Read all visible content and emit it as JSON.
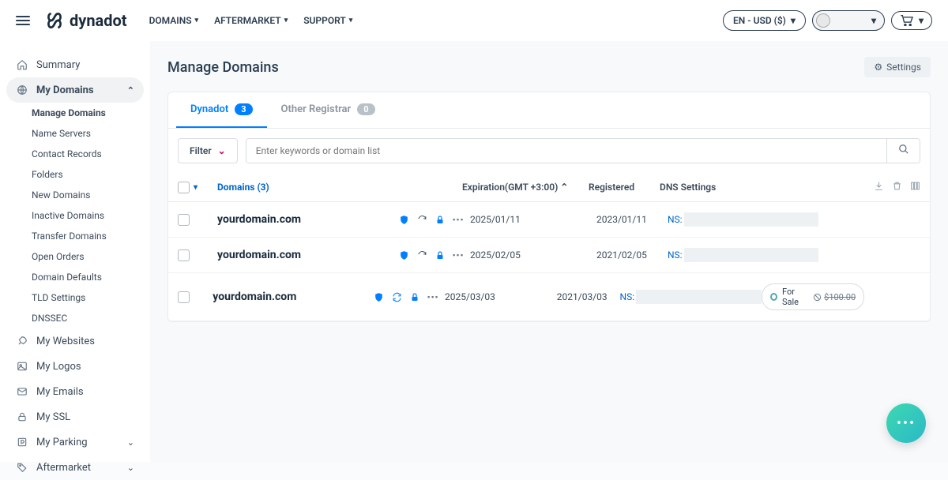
{
  "header": {
    "brand": "dynadot",
    "nav": [
      "DOMAINS",
      "AFTERMARKET",
      "SUPPORT"
    ],
    "locale": "EN - USD ($)"
  },
  "sidebar": {
    "summary": "Summary",
    "myDomains": "My Domains",
    "sub": {
      "manage": "Manage Domains",
      "ns": "Name Servers",
      "contacts": "Contact Records",
      "folders": "Folders",
      "newd": "New Domains",
      "inactive": "Inactive Domains",
      "transfer": "Transfer Domains",
      "open": "Open Orders",
      "defaults": "Domain Defaults",
      "tld": "TLD Settings",
      "dnssec": "DNSSEC"
    },
    "myWebsites": "My Websites",
    "myLogos": "My Logos",
    "myEmails": "My Emails",
    "mySSL": "My SSL",
    "myParking": "My Parking",
    "aftermarket": "Aftermarket"
  },
  "page": {
    "title": "Manage Domains",
    "settingsBtn": "Settings"
  },
  "tabs": {
    "dynadot": "Dynadot",
    "dynadotCount": "3",
    "other": "Other Registrar",
    "otherCount": "0"
  },
  "toolbar": {
    "filter": "Filter",
    "searchPlaceholder": "Enter keywords or domain list"
  },
  "columns": {
    "domains": "Domains (3)",
    "expiration": "Expiration(GMT +3:00)",
    "registered": "Registered",
    "dns": "DNS Settings"
  },
  "rows": [
    {
      "domain": "yourdomain.com",
      "exp": "2025/01/11",
      "reg": "2023/01/11",
      "dns": "NS:",
      "forSale": false
    },
    {
      "domain": "yourdomain.com",
      "exp": "2025/02/05",
      "reg": "2021/02/05",
      "dns": "NS:",
      "forSale": false
    },
    {
      "domain": "yourdomain.com",
      "exp": "2025/03/03",
      "reg": "2021/03/03",
      "dns": "NS:",
      "forSale": true,
      "forSaleLabel": "For Sale",
      "price": "$100.00"
    }
  ]
}
